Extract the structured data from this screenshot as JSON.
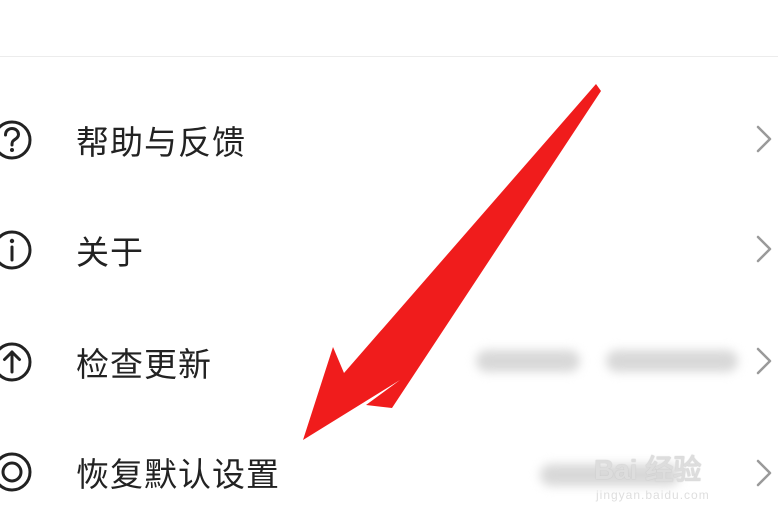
{
  "menu": {
    "items": [
      {
        "label": "帮助与反馈",
        "icon": "help-circle-icon"
      },
      {
        "label": "关于",
        "icon": "info-circle-icon"
      },
      {
        "label": "检查更新",
        "icon": "arrow-up-circle-icon"
      },
      {
        "label": "恢复默认设置",
        "icon": "reset-circle-icon"
      }
    ]
  },
  "annotation": {
    "arrow_color": "#f01c1c"
  },
  "watermark": {
    "brand": "Bai 经验",
    "sub": "jingyan.baidu.com"
  }
}
